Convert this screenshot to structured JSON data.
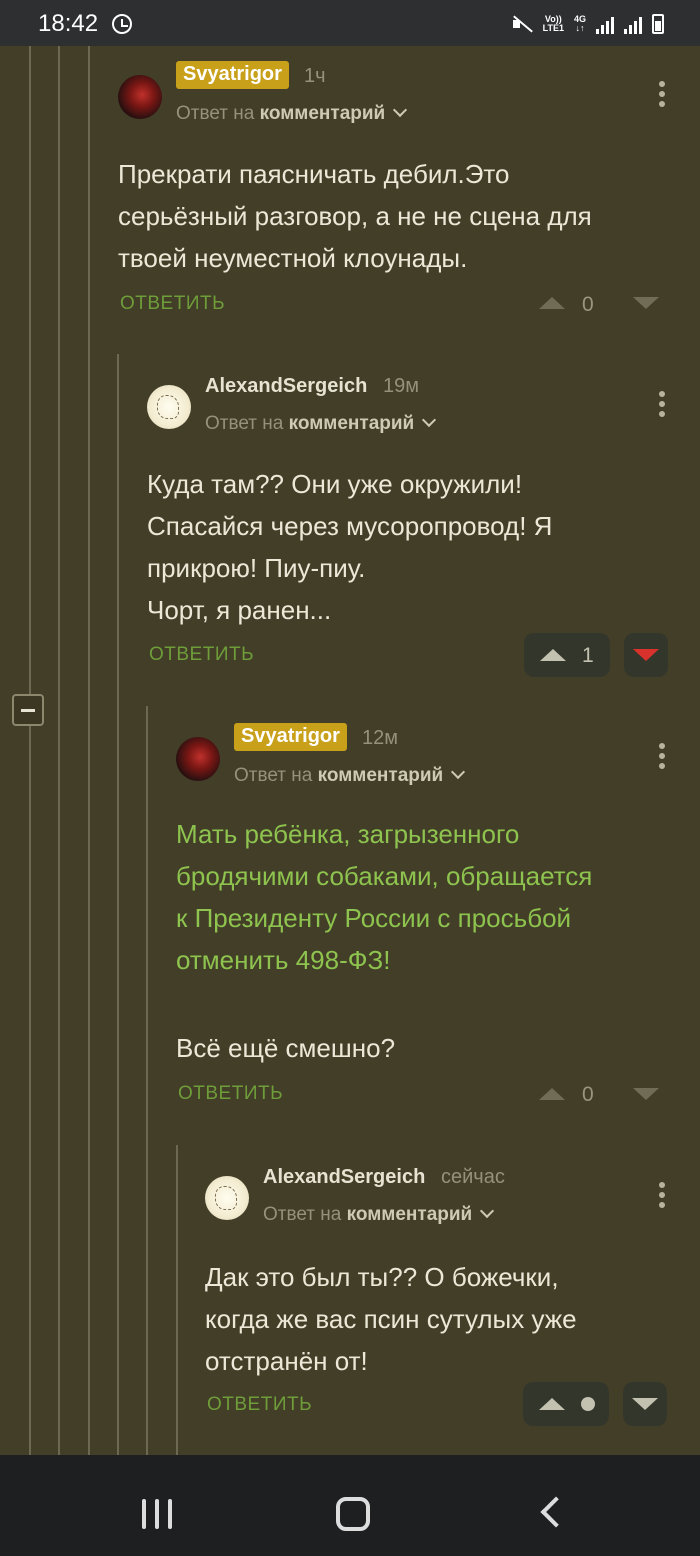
{
  "status_bar": {
    "time": "18:42",
    "network_top": "Vo))",
    "network_bottom": "LTE1",
    "network_gen": "4G"
  },
  "comments": [
    {
      "author": "Svyatrigor",
      "time": "1ч",
      "reply_prefix": "Ответ на",
      "reply_target": "комментарий",
      "text": "Прекрати паясничать дебил.Это\nсерьёзный разговор, а не не сцена для\nтвоей неуместной клоунады.",
      "reply_label": "ОТВЕТИТЬ",
      "score": "0"
    },
    {
      "author": "AlexandSergeich",
      "time": "19м",
      "reply_prefix": "Ответ на",
      "reply_target": "комментарий",
      "text": "Куда там?? Они уже окружили!\nСпасайся через мусоропровод! Я\nприкрою! Пиу-пиу.\nЧорт, я ранен...",
      "reply_label": "ОТВЕТИТЬ",
      "score": "1"
    },
    {
      "author": "Svyatrigor",
      "time": "12м",
      "reply_prefix": "Ответ на",
      "reply_target": "комментарий",
      "link_text": "Мать ребёнка, загрызенного\nбродячими собаками, обращается\nк Президенту России с просьбой\nотменить 498-ФЗ!",
      "text": "Всё ещё смешно?",
      "reply_label": "ОТВЕТИТЬ",
      "score": "0"
    },
    {
      "author": "AlexandSergeich",
      "time": "сейчас",
      "reply_prefix": "Ответ на",
      "reply_target": "комментарий",
      "text": "Дак это был ты?? О божечки,\nкогда же вас псин сутулых уже\nотстранён от!",
      "reply_label": "ОТВЕТИТЬ"
    }
  ]
}
